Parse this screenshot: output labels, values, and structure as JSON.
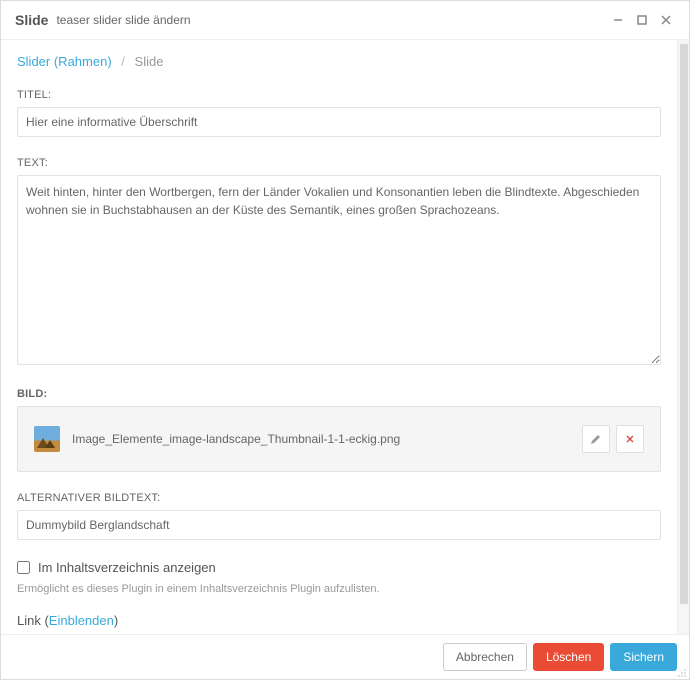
{
  "window": {
    "title_strong": "Slide",
    "title_sub": "teaser slider slide ändern"
  },
  "breadcrumb": {
    "link": "Slider (Rahmen)",
    "current": "Slide"
  },
  "fields": {
    "titel": {
      "label": "TITEL:",
      "value": "Hier eine informative Überschrift"
    },
    "text": {
      "label": "TEXT:",
      "value": "Weit hinten, hinter den Wortbergen, fern der Länder Vokalien und Konsonantien leben die Blindtexte. Abgeschieden wohnen sie in Buchstabhausen an der Küste des Semantik, eines großen Sprachozeans."
    },
    "bild": {
      "label": "BILD:",
      "filename": "Image_Elemente_image-landscape_Thumbnail-1-1-eckig.png"
    },
    "alt": {
      "label": "ALTERNATIVER BILDTEXT:",
      "value": "Dummybild Berglandschaft"
    },
    "toc": {
      "label": "Im Inhaltsverzeichnis anzeigen",
      "help": "Ermöglicht es dieses Plugin in einem Inhaltsverzeichnis Plugin aufzulisten."
    },
    "link": {
      "label_prefix": "Link (",
      "toggle": "Einblenden",
      "label_suffix": ")"
    }
  },
  "buttons": {
    "cancel": "Abbrechen",
    "delete": "Löschen",
    "save": "Sichern"
  }
}
